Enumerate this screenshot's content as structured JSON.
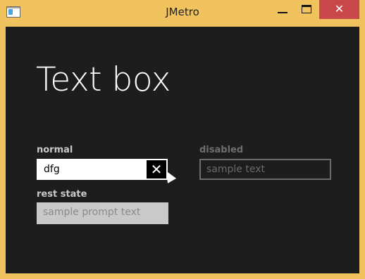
{
  "window": {
    "title": "JMetro",
    "minimize_icon": "minimize-icon",
    "maximize_icon": "maximize-icon",
    "close_glyph": "✕",
    "close_icon": "close-icon",
    "frame_color": "#f0c35f",
    "close_color": "#c8474a"
  },
  "page": {
    "title": "Text box",
    "background": "#1d1d1d"
  },
  "fields": {
    "normal": {
      "label": "normal",
      "value": "dfg",
      "clear_glyph": "✕"
    },
    "disabled": {
      "label": "disabled",
      "placeholder": "sample text"
    },
    "rest": {
      "label": "rest state",
      "placeholder": "sample prompt text"
    }
  }
}
